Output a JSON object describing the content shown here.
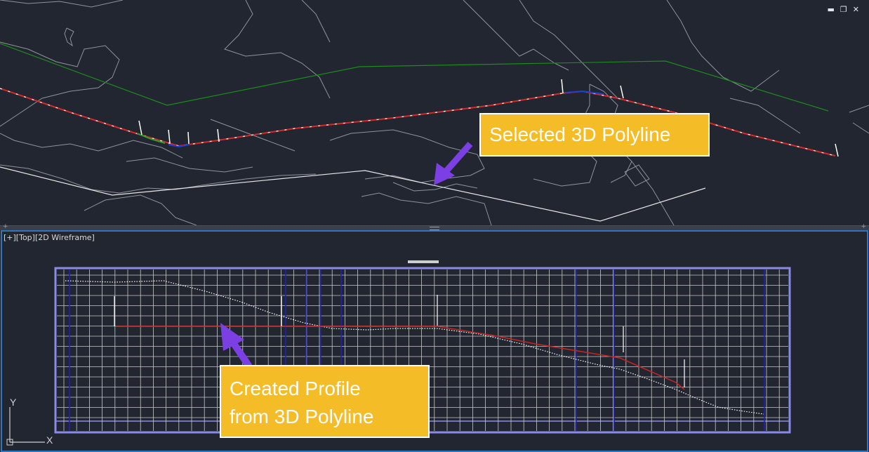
{
  "window_controls": {
    "minimize": "▬",
    "restore": "❐",
    "close": "✕"
  },
  "viewport_label": "[+][Top][2D Wireframe]",
  "callouts": {
    "selected": "Selected 3D Polyline",
    "created_line1": "Created Profile",
    "created_line2": "from 3D Polyline"
  },
  "ucs": {
    "y": "Y",
    "x": "X"
  },
  "colors": {
    "background": "#212630",
    "callout_fill": "#f4bc27",
    "arrow": "#7b3fe4",
    "polyline": "#d42a2a",
    "green_line": "#1f8a1f",
    "viewport_border": "#2f74c0",
    "grid_frame": "#8a8ae8"
  },
  "icons": [
    "minimize-icon",
    "restore-icon",
    "close-icon",
    "ucs-icon",
    "arrow-icon"
  ]
}
